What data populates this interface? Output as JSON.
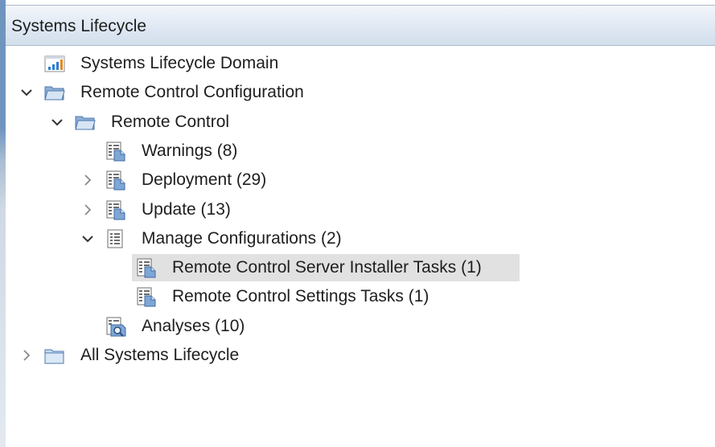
{
  "panel": {
    "title": "Systems Lifecycle"
  },
  "tree": {
    "items": [
      {
        "label": "Systems Lifecycle Domain",
        "icon": "domain-chart-icon",
        "expander": "none",
        "level": 0
      },
      {
        "label": "Remote Control Configuration",
        "icon": "folder-open-icon",
        "expander": "expanded",
        "level": 0
      },
      {
        "label": "Remote Control",
        "icon": "folder-open-icon",
        "expander": "expanded",
        "level": 1
      },
      {
        "label": "Warnings (8)",
        "icon": "report-icon",
        "expander": "none",
        "level": 2
      },
      {
        "label": "Deployment (29)",
        "icon": "report-icon",
        "expander": "collapsed",
        "level": 2
      },
      {
        "label": "Update (13)",
        "icon": "report-icon",
        "expander": "collapsed",
        "level": 2
      },
      {
        "label": "Manage Configurations (2)",
        "icon": "list-icon",
        "expander": "expanded",
        "level": 2
      },
      {
        "label": "Remote Control Server Installer Tasks (1)",
        "icon": "report-icon",
        "expander": "none",
        "level": 3,
        "selected": true
      },
      {
        "label": "Remote Control Settings Tasks (1)",
        "icon": "report-icon",
        "expander": "none",
        "level": 3
      },
      {
        "label": "Analyses (10)",
        "icon": "analysis-icon",
        "expander": "none",
        "level": 2
      },
      {
        "label": "All Systems Lifecycle",
        "icon": "folder-closed-icon",
        "expander": "collapsed",
        "level": 0
      }
    ]
  },
  "colors": {
    "selection": "#e1e1e1",
    "accent": "#6f95bf",
    "folder": "#6a93c8"
  }
}
